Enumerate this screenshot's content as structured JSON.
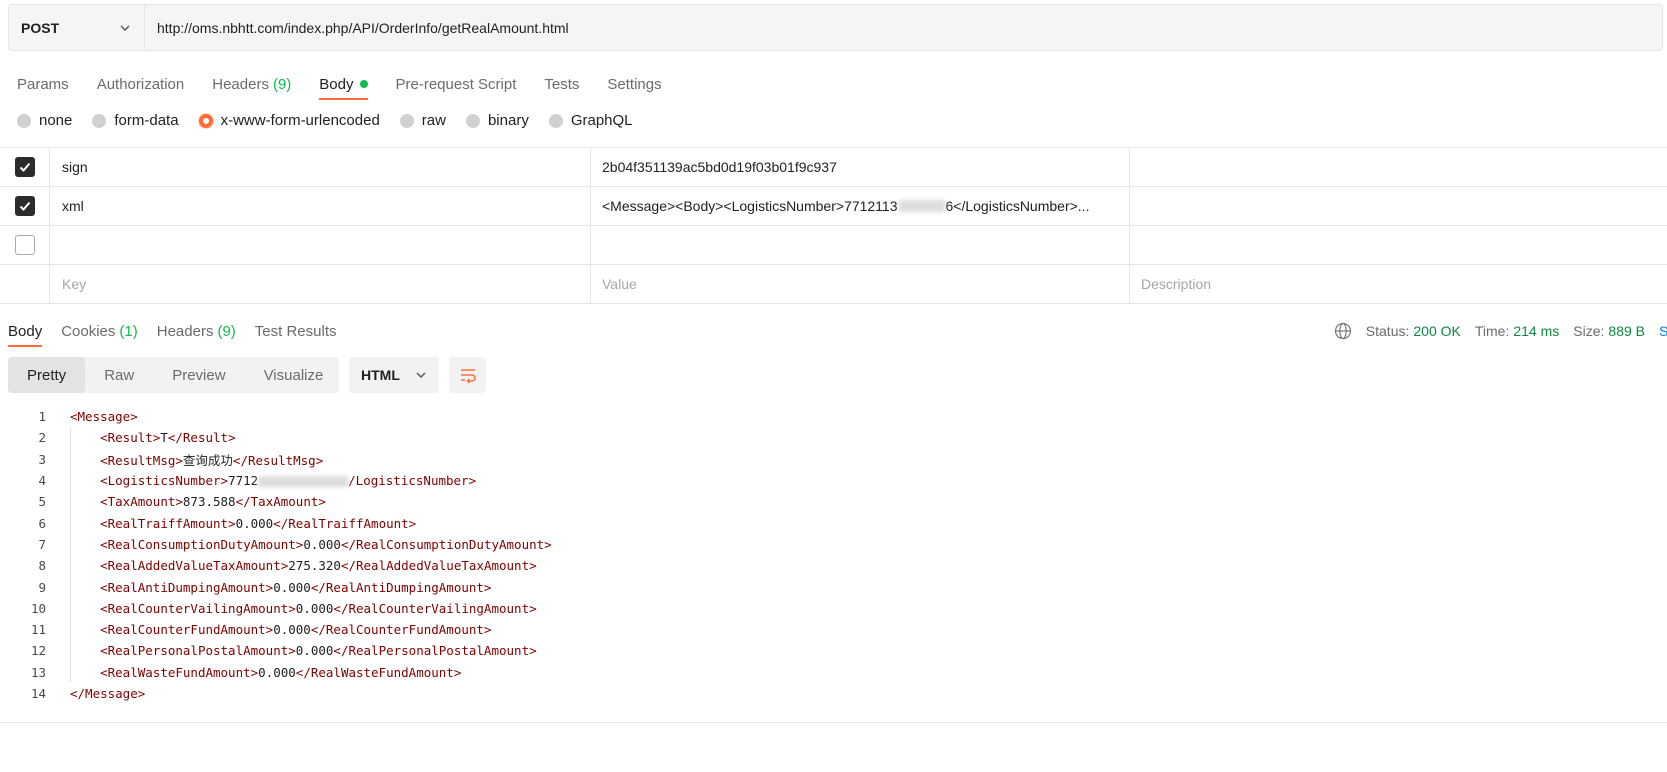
{
  "request": {
    "method": "POST",
    "url": "http://oms.nbhtt.com/index.php/API/OrderInfo/getRealAmount.html"
  },
  "req_tabs": [
    {
      "label": "Params"
    },
    {
      "label": "Authorization"
    },
    {
      "label": "Headers",
      "count": "(9)"
    },
    {
      "label": "Body"
    },
    {
      "label": "Pre-request Script"
    },
    {
      "label": "Tests"
    },
    {
      "label": "Settings"
    }
  ],
  "body_types": [
    "none",
    "form-data",
    "x-www-form-urlencoded",
    "raw",
    "binary",
    "GraphQL"
  ],
  "params": {
    "rows": [
      {
        "key": "sign",
        "value": "2b04f351139ac5bd0d19f03b01f9c937"
      },
      {
        "key": "xml",
        "value_prefix": "<Message><Body><LogisticsNumber>7712113",
        "value_suffix": "6</LogisticsNumber>..."
      }
    ],
    "placeholders": {
      "key": "Key",
      "value": "Value",
      "description": "Description"
    }
  },
  "resp_tabs": [
    {
      "label": "Body"
    },
    {
      "label": "Cookies",
      "count": "(1)"
    },
    {
      "label": "Headers",
      "count": "(9)"
    },
    {
      "label": "Test Results"
    }
  ],
  "status": {
    "status_label": "Status:",
    "status_value": "200 OK",
    "time_label": "Time:",
    "time_value": "214 ms",
    "size_label": "Size:",
    "size_value": "889 B",
    "save_partial": "S"
  },
  "view_modes": [
    "Pretty",
    "Raw",
    "Preview",
    "Visualize"
  ],
  "format": "HTML",
  "code_lines": [
    {
      "n": "1",
      "indent": "",
      "open": "<Message>",
      "text": "",
      "close": ""
    },
    {
      "n": "2",
      "indent": "    ",
      "open": "<Result>",
      "text": "T",
      "close": "</Result>"
    },
    {
      "n": "3",
      "indent": "    ",
      "open": "<ResultMsg>",
      "text": "查询成功",
      "close": "</ResultMsg>"
    },
    {
      "n": "4",
      "indent": "    ",
      "open": "<LogisticsNumber>",
      "text": "7712",
      "close": "/LogisticsNumber>"
    },
    {
      "n": "5",
      "indent": "    ",
      "open": "<TaxAmount>",
      "text": "873.588",
      "close": "</TaxAmount>"
    },
    {
      "n": "6",
      "indent": "    ",
      "open": "<RealTraiffAmount>",
      "text": "0.000",
      "close": "</RealTraiffAmount>"
    },
    {
      "n": "7",
      "indent": "    ",
      "open": "<RealConsumptionDutyAmount>",
      "text": "0.000",
      "close": "</RealConsumptionDutyAmount>"
    },
    {
      "n": "8",
      "indent": "    ",
      "open": "<RealAddedValueTaxAmount>",
      "text": "275.320",
      "close": "</RealAddedValueTaxAmount>"
    },
    {
      "n": "9",
      "indent": "    ",
      "open": "<RealAntiDumpingAmount>",
      "text": "0.000",
      "close": "</RealAntiDumpingAmount>"
    },
    {
      "n": "10",
      "indent": "    ",
      "open": "<RealCounterVailingAmount>",
      "text": "0.000",
      "close": "</RealCounterVailingAmount>"
    },
    {
      "n": "11",
      "indent": "    ",
      "open": "<RealCounterFundAmount>",
      "text": "0.000",
      "close": "</RealCounterFundAmount>"
    },
    {
      "n": "12",
      "indent": "    ",
      "open": "<RealPersonalPostalAmount>",
      "text": "0.000",
      "close": "</RealPersonalPostalAmount>"
    },
    {
      "n": "13",
      "indent": "    ",
      "open": "<RealWasteFundAmount>",
      "text": "0.000",
      "close": "</RealWasteFundAmount>"
    },
    {
      "n": "14",
      "indent": "",
      "open": "</Message>",
      "text": "",
      "close": ""
    }
  ],
  "colors": {
    "accent": "#ff6c37",
    "success": "#0cbb52",
    "xml_tag": "#800000"
  }
}
